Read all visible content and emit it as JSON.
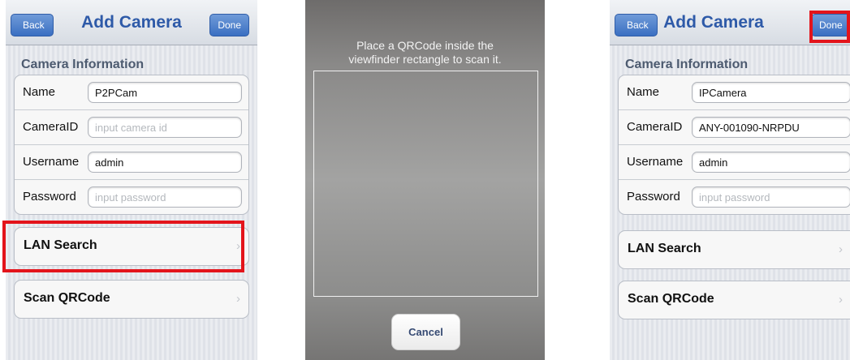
{
  "left_screen": {
    "nav": {
      "back": "Back",
      "title": "Add Camera",
      "done": "Done"
    },
    "section_title": "Camera Information",
    "fields": [
      {
        "label": "Name",
        "value": "P2PCam",
        "placeholder": ""
      },
      {
        "label": "CameraID",
        "value": "",
        "placeholder": "input camera id"
      },
      {
        "label": "Username",
        "value": "admin",
        "placeholder": ""
      },
      {
        "label": "Password",
        "value": "",
        "placeholder": "input password"
      }
    ],
    "actions": {
      "lan_search": "LAN Search",
      "scan_qrcode": "Scan QRCode"
    }
  },
  "camera_screen": {
    "prompt_line1": "Place a QRCode inside the",
    "prompt_line2": "viewfinder rectangle to scan it.",
    "cancel": "Cancel"
  },
  "right_screen": {
    "nav": {
      "back": "Back",
      "title": "Add Camera",
      "done": "Done"
    },
    "section_title": "Camera Information",
    "fields": [
      {
        "label": "Name",
        "value": "IPCamera",
        "placeholder": ""
      },
      {
        "label": "CameraID",
        "value": "ANY-001090-NRPDU",
        "placeholder": ""
      },
      {
        "label": "Username",
        "value": "admin",
        "placeholder": ""
      },
      {
        "label": "Password",
        "value": "",
        "placeholder": "input password"
      }
    ],
    "actions": {
      "lan_search": "LAN Search",
      "scan_qrcode": "Scan QRCode"
    }
  },
  "icons": {
    "chevron": "chevron-right-icon",
    "back": "back-arrow-icon"
  },
  "colors": {
    "highlight": "#e3141b",
    "title": "#2e5aa8",
    "button": "#3a6fc2"
  }
}
